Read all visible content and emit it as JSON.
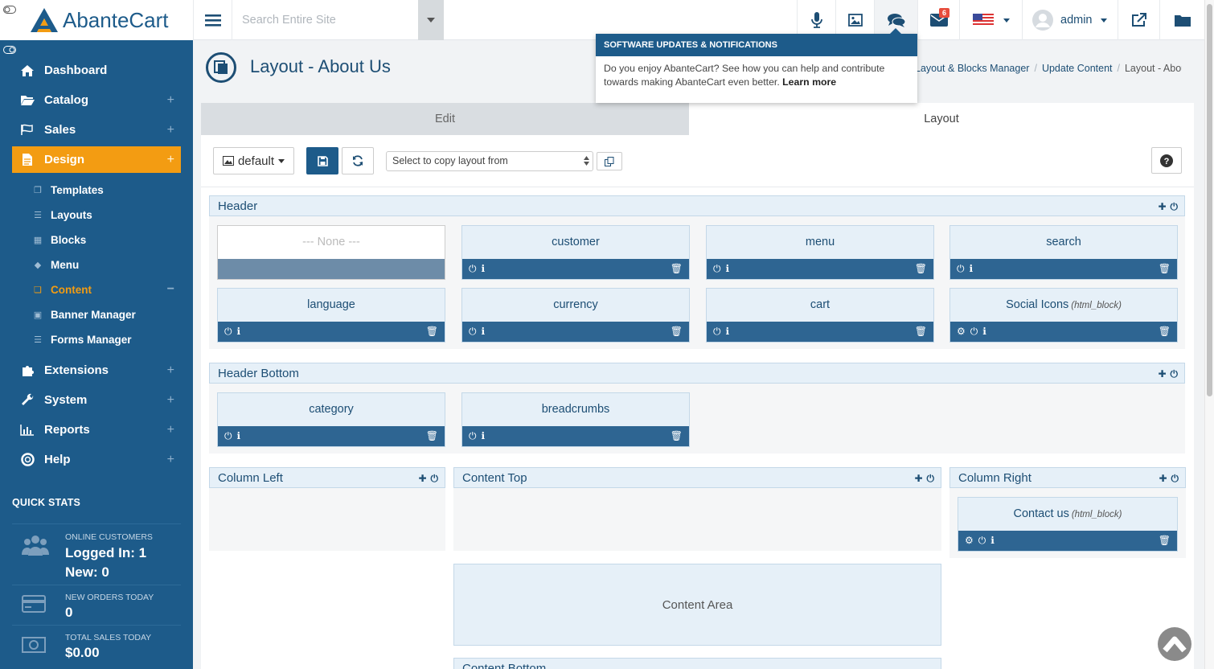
{
  "brand": {
    "name": "AbanteCart"
  },
  "sidebar": {
    "items": [
      {
        "label": "Dashboard",
        "icon": "home-icon"
      },
      {
        "label": "Catalog",
        "icon": "folder-open-icon"
      },
      {
        "label": "Sales",
        "icon": "flag-icon"
      },
      {
        "label": "Design",
        "icon": "file-icon"
      },
      {
        "label": "Extensions",
        "icon": "puzzle-icon"
      },
      {
        "label": "System",
        "icon": "wrench-icon"
      },
      {
        "label": "Reports",
        "icon": "bar-chart-icon"
      },
      {
        "label": "Help",
        "icon": "life-ring-icon"
      }
    ],
    "design_sub": [
      {
        "label": "Templates"
      },
      {
        "label": "Layouts"
      },
      {
        "label": "Blocks"
      },
      {
        "label": "Menu"
      },
      {
        "label": "Content"
      },
      {
        "label": "Banner Manager"
      },
      {
        "label": "Forms Manager"
      }
    ],
    "quick_stats": {
      "title": "QUICK STATS",
      "online_label": "ONLINE CUSTOMERS",
      "logged_in": "Logged In: 1",
      "new": "New: 0",
      "orders_label": "NEW ORDERS TODAY",
      "orders_value": "0",
      "sales_label": "TOTAL SALES TODAY",
      "sales_value": "$0.00"
    }
  },
  "topbar": {
    "search_placeholder": "Search Entire Site",
    "messages_count": "6",
    "user": "admin"
  },
  "notification": {
    "title": "SOFTWARE UPDATES & NOTIFICATIONS",
    "body": "Do you enjoy AbanteCart? See how you can help and contribute towards making AbanteCart even better.",
    "link": "Learn more"
  },
  "page": {
    "title": "Layout - About Us",
    "breadcrumb": [
      "Layout & Blocks Manager",
      "Update Content",
      "Layout - About Us"
    ]
  },
  "tabs": {
    "edit": "Edit",
    "layout": "Layout"
  },
  "toolbar": {
    "template": "default",
    "copy_placeholder": "Select to copy layout from"
  },
  "sections": {
    "header": {
      "title": "Header",
      "blocks": [
        {
          "name": "--- None ---"
        },
        {
          "name": "customer"
        },
        {
          "name": "menu"
        },
        {
          "name": "search"
        },
        {
          "name": "language"
        },
        {
          "name": "currency"
        },
        {
          "name": "cart"
        },
        {
          "name": "Social Icons",
          "type": "(html_block)"
        }
      ]
    },
    "header_bottom": {
      "title": "Header Bottom",
      "blocks": [
        {
          "name": "category"
        },
        {
          "name": "breadcrumbs"
        }
      ]
    },
    "column_left": {
      "title": "Column Left"
    },
    "content_top": {
      "title": "Content Top"
    },
    "column_right": {
      "title": "Column Right",
      "blocks": [
        {
          "name": "Contact us",
          "type": "(html_block)"
        }
      ]
    },
    "content_area": "Content Area",
    "content_bottom": {
      "title": "Content Bottom"
    }
  },
  "colors": {
    "sidebar": "#1d5b8a",
    "accent": "#f39c12",
    "block_bar": "#2e6592"
  }
}
